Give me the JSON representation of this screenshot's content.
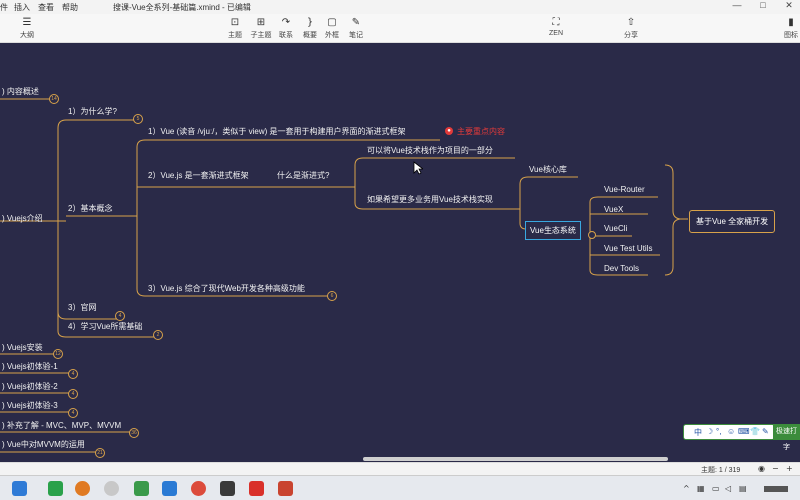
{
  "window": {
    "menus": [
      "件",
      "插入",
      "查看",
      "帮助"
    ],
    "title": "搜课-Vue全系列-基础篇.xmind - 已编辑",
    "controls": [
      "—",
      "□",
      "✕"
    ]
  },
  "toolbar": {
    "left": [
      {
        "icon": "outline-icon",
        "glyph": "☰",
        "label": "大纲"
      }
    ],
    "tools": [
      {
        "icon": "topic-icon",
        "glyph": "⊡",
        "label": "主题"
      },
      {
        "icon": "subtopic-icon",
        "glyph": "⊞",
        "label": "子主题"
      },
      {
        "icon": "relationship-icon",
        "glyph": "↷",
        "label": "联系"
      },
      {
        "icon": "summary-icon",
        "glyph": "}",
        "label": "概要"
      },
      {
        "icon": "boundary-icon",
        "glyph": "▢",
        "label": "外框"
      },
      {
        "icon": "note-icon",
        "glyph": "✎",
        "label": "笔记"
      }
    ],
    "zen": {
      "icon": "zen-icon",
      "glyph": "⛶",
      "label": "ZEN"
    },
    "share": {
      "icon": "share-icon",
      "glyph": "⇧",
      "label": "分享"
    },
    "panel": {
      "icon": "panel-icon",
      "glyph": "▮",
      "label": "图标"
    }
  },
  "mindmap": {
    "left_branches": [
      {
        "label": ") 内容概述",
        "badge": "14"
      },
      {
        "label": ") Vuejs介绍",
        "badge": ""
      },
      {
        "label": ") Vuejs安装",
        "badge": "12"
      },
      {
        "label": ") Vuejs初体验-1",
        "badge": "4"
      },
      {
        "label": ") Vuejs初体验-2",
        "badge": "4"
      },
      {
        "label": ") Vuejs初体验-3",
        "badge": "4"
      },
      {
        "label": ") 补充了解 - MVC、MVP、MVVM",
        "badge": "36"
      },
      {
        "label": ") Vue中对MVVM的运用",
        "badge": "21"
      }
    ],
    "intro_children": [
      {
        "label": "1）为什么学?",
        "badge": "5"
      },
      {
        "label": "2）基本概念",
        "badge": ""
      },
      {
        "label": "3）官网",
        "badge": "4"
      },
      {
        "label": "4）学习Vue所需基础",
        "badge": "2"
      }
    ],
    "concept_children": [
      {
        "label": "1）Vue (读音 /vjuː/，类似于 view) 是一套用于构建用户界面的渐进式框架",
        "badge": ""
      },
      {
        "label": "2）Vue.js 是一套渐进式框架",
        "badge": ""
      },
      {
        "label": "3）Vue.js 综合了现代Web开发各种高级功能",
        "badge": "6"
      }
    ],
    "red_tag": "主要重点内容",
    "progressive_question": "什么是渐进式?",
    "progressive_answers": [
      "可以将Vue技术栈作为项目的一部分",
      "如果希望更多业务用Vue技术栈实现"
    ],
    "core_lib": "Vue核心库",
    "ecosystem": "Vue生态系统",
    "eco_items": [
      "Vue-Router",
      "VueX",
      "VueCli",
      "Vue  Test Utils",
      "Dev Tools"
    ],
    "fullstack": "基于Vue 全家桶开发"
  },
  "ime": {
    "items": [
      "中",
      "☽",
      "°,",
      "☺",
      "⌨",
      "👕",
      "✎"
    ],
    "extra": "极速打字"
  },
  "status": {
    "count": "主题: 1 / 319",
    "icons": [
      "eye-icon",
      "zoom-out-icon",
      "zoom-in-icon"
    ]
  },
  "colors": {
    "canvas": "#2a2a48",
    "branch_line": "#d8a24a",
    "selected_border": "#39a8e0",
    "highlight": "#e23a3a"
  }
}
